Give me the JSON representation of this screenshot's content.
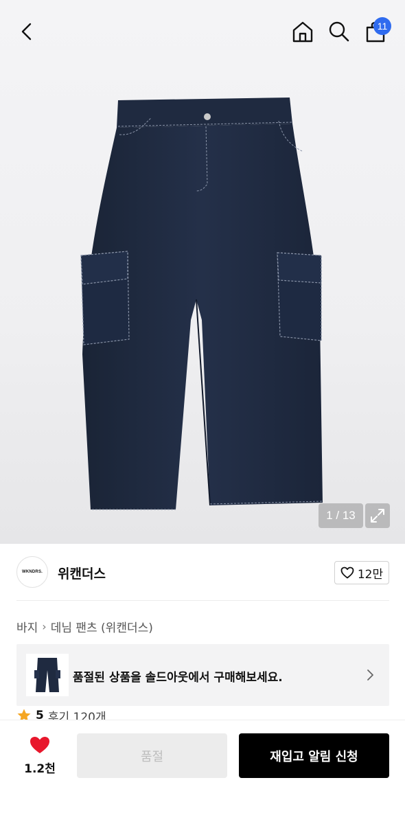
{
  "header": {
    "cart_count": "11",
    "icons": [
      "back-icon",
      "home-icon",
      "search-icon",
      "cart-icon"
    ]
  },
  "gallery": {
    "counter": "1 / 13",
    "icons": [
      "expand-icon"
    ]
  },
  "brand": {
    "logo_text": "WKNDRS.",
    "name": "위캔더스",
    "like_count": "12만"
  },
  "breadcrumb": {
    "category": "바지",
    "product": "데님 팬츠 (위캔더스)"
  },
  "banner": {
    "text": "품절된 상품을 솔드아웃에서 구매해보세요."
  },
  "rating": {
    "score": "5",
    "reviews": "후기 120개"
  },
  "bottom": {
    "wish_count": "1.2천",
    "soldout_label": "품절",
    "restock_label": "재입고 알림 신청"
  },
  "colors": {
    "accent_badge": "#2f6bef",
    "like_heart": "#e8172c",
    "star": "#f5a623",
    "primary_button": "#000000"
  }
}
